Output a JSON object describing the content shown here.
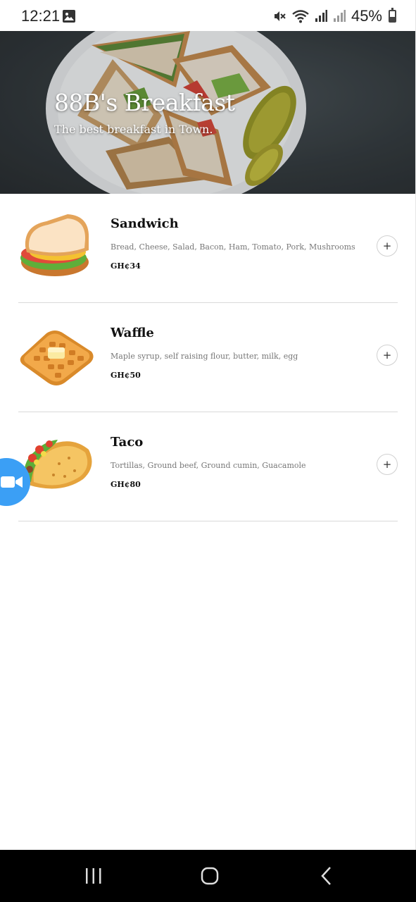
{
  "status_bar": {
    "time": "12:21",
    "battery": "45%",
    "battery_level": 0.45,
    "icons": [
      "gallery-icon",
      "mute-icon",
      "wifi-icon",
      "signal-icon",
      "signal-icon",
      "battery-icon"
    ]
  },
  "header": {
    "title": "88B's Breakfast",
    "subtitle": "The best breakfast in Town."
  },
  "menu": {
    "items": [
      {
        "name": "Sandwich",
        "description": "Bread, Cheese, Salad, Bacon, Ham, Tomato, Pork, Mushrooms",
        "price": "GH¢34",
        "image": "sandwich-emoji",
        "add_label": "+"
      },
      {
        "name": "Waffle",
        "description": "Maple syrup, self raising flour, butter, milk, egg",
        "price": "GH¢50",
        "image": "waffle-emoji",
        "add_label": "+"
      },
      {
        "name": "Taco",
        "description": "Tortillas, Ground beef, Ground cumin, Guacamole",
        "price": "GH¢80",
        "image": "taco-emoji",
        "add_label": "+"
      }
    ]
  },
  "floating_bubble": {
    "icon": "video-camera-icon",
    "color": "#3b9ff5"
  },
  "nav_bar": {
    "icons": [
      "recent-apps-icon",
      "home-icon",
      "back-icon"
    ]
  }
}
